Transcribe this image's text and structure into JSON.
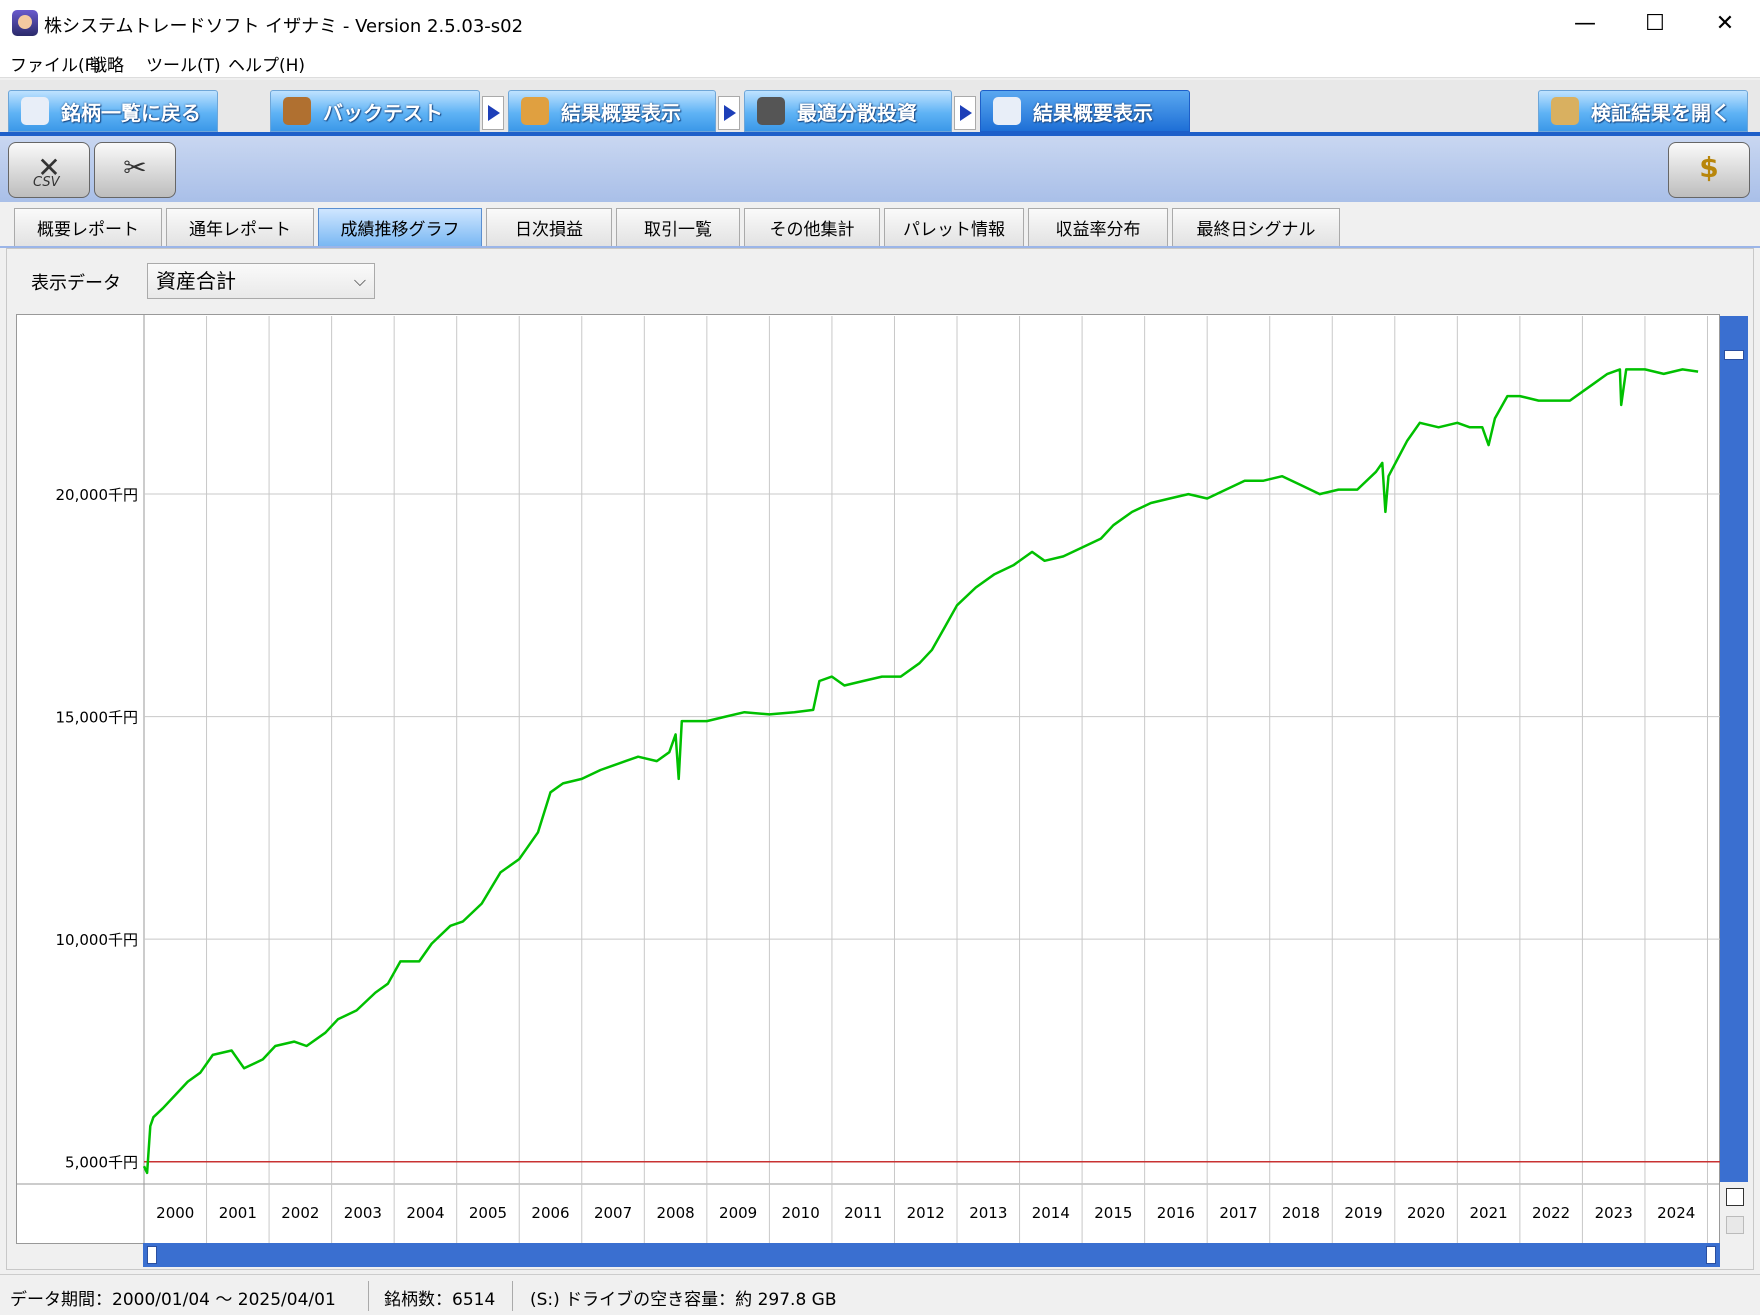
{
  "window": {
    "title": "株システムトレードソフト イザナミ - Version 2.5.03-s02",
    "minimize": "—",
    "maximize": "☐",
    "close": "✕"
  },
  "menu": [
    "ファイル(F)",
    "戦略",
    "ツール(T)",
    "ヘルプ(H)"
  ],
  "main_tabs": {
    "back": "銘柄一覧に戻る",
    "backtest": "バックテスト",
    "summary1": "結果概要表示",
    "optimal": "最適分散投資",
    "summary2": "結果概要表示",
    "open_results": "検証結果を開く"
  },
  "toolbar": {
    "csv_label": "CSV"
  },
  "sub_tabs": [
    "概要レポート",
    "通年レポート",
    "成績推移グラフ",
    "日次損益",
    "取引一覧",
    "その他集計",
    "パレット情報",
    "収益率分布",
    "最終日シグナル"
  ],
  "active_sub_tab": "成績推移グラフ",
  "display_data": {
    "label": "表示データ",
    "selected": "資産合計"
  },
  "colors": {
    "line": "#00c000",
    "baseline": "#c83232",
    "accent": "#1d5fc9"
  },
  "chart_data": {
    "type": "line",
    "series": [
      {
        "values": [
          [
            2000.0,
            4900
          ],
          [
            2000.05,
            4750
          ],
          [
            2000.1,
            5800
          ],
          [
            2000.15,
            6000
          ],
          [
            2000.3,
            6200
          ],
          [
            2000.5,
            6500
          ],
          [
            2000.7,
            6800
          ],
          [
            2000.9,
            7000
          ],
          [
            2001.1,
            7400
          ],
          [
            2001.4,
            7500
          ],
          [
            2001.6,
            7100
          ],
          [
            2001.9,
            7300
          ],
          [
            2002.1,
            7600
          ],
          [
            2002.4,
            7700
          ],
          [
            2002.6,
            7600
          ],
          [
            2002.9,
            7900
          ],
          [
            2003.1,
            8200
          ],
          [
            2003.4,
            8400
          ],
          [
            2003.7,
            8800
          ],
          [
            2003.9,
            9000
          ],
          [
            2004.1,
            9500
          ],
          [
            2004.4,
            9500
          ],
          [
            2004.6,
            9900
          ],
          [
            2004.9,
            10300
          ],
          [
            2005.1,
            10400
          ],
          [
            2005.4,
            10800
          ],
          [
            2005.7,
            11500
          ],
          [
            2006.0,
            11800
          ],
          [
            2006.1,
            12000
          ],
          [
            2006.3,
            12400
          ],
          [
            2006.5,
            13300
          ],
          [
            2006.7,
            13500
          ],
          [
            2007.0,
            13600
          ],
          [
            2007.3,
            13800
          ],
          [
            2007.5,
            13900
          ],
          [
            2007.7,
            14000
          ],
          [
            2007.9,
            14100
          ],
          [
            2008.2,
            14000
          ],
          [
            2008.4,
            14200
          ],
          [
            2008.5,
            14600
          ],
          [
            2008.55,
            13600
          ],
          [
            2008.6,
            14900
          ],
          [
            2009.0,
            14900
          ],
          [
            2009.3,
            15000
          ],
          [
            2009.6,
            15100
          ],
          [
            2010.0,
            15050
          ],
          [
            2010.4,
            15100
          ],
          [
            2010.7,
            15150
          ],
          [
            2010.8,
            15800
          ],
          [
            2011.0,
            15900
          ],
          [
            2011.2,
            15700
          ],
          [
            2011.5,
            15800
          ],
          [
            2011.8,
            15900
          ],
          [
            2012.1,
            15900
          ],
          [
            2012.4,
            16200
          ],
          [
            2012.6,
            16500
          ],
          [
            2012.8,
            17000
          ],
          [
            2013.0,
            17500
          ],
          [
            2013.3,
            17900
          ],
          [
            2013.6,
            18200
          ],
          [
            2013.9,
            18400
          ],
          [
            2014.2,
            18700
          ],
          [
            2014.4,
            18500
          ],
          [
            2014.7,
            18600
          ],
          [
            2015.0,
            18800
          ],
          [
            2015.3,
            19000
          ],
          [
            2015.5,
            19300
          ],
          [
            2015.8,
            19600
          ],
          [
            2016.1,
            19800
          ],
          [
            2016.4,
            19900
          ],
          [
            2016.7,
            20000
          ],
          [
            2017.0,
            19900
          ],
          [
            2017.3,
            20100
          ],
          [
            2017.6,
            20300
          ],
          [
            2017.9,
            20300
          ],
          [
            2018.2,
            20400
          ],
          [
            2018.5,
            20200
          ],
          [
            2018.8,
            20000
          ],
          [
            2019.1,
            20100
          ],
          [
            2019.4,
            20100
          ],
          [
            2019.7,
            20500
          ],
          [
            2019.8,
            20700
          ],
          [
            2019.85,
            19600
          ],
          [
            2019.9,
            20400
          ],
          [
            2020.2,
            21200
          ],
          [
            2020.4,
            21600
          ],
          [
            2020.7,
            21500
          ],
          [
            2021.0,
            21600
          ],
          [
            2021.2,
            21500
          ],
          [
            2021.4,
            21500
          ],
          [
            2021.5,
            21100
          ],
          [
            2021.6,
            21700
          ],
          [
            2021.8,
            22200
          ],
          [
            2022.0,
            22200
          ],
          [
            2022.3,
            22100
          ],
          [
            2022.5,
            22100
          ],
          [
            2022.8,
            22100
          ],
          [
            2023.0,
            22300
          ],
          [
            2023.2,
            22500
          ],
          [
            2023.4,
            22700
          ],
          [
            2023.6,
            22800
          ],
          [
            2023.62,
            22000
          ],
          [
            2023.7,
            22800
          ],
          [
            2024.0,
            22800
          ],
          [
            2024.3,
            22700
          ],
          [
            2024.6,
            22800
          ],
          [
            2024.85,
            22750
          ]
        ]
      }
    ],
    "baseline": 5000,
    "y_ticks": [
      {
        "value": 5000,
        "label": "5,000千円"
      },
      {
        "value": 10000,
        "label": "10,000千円"
      },
      {
        "value": 15000,
        "label": "15,000千円"
      },
      {
        "value": 20000,
        "label": "20,000千円"
      }
    ],
    "x_ticks": [
      "2000",
      "2001",
      "2002",
      "2003",
      "2004",
      "2005",
      "2006",
      "2007",
      "2008",
      "2009",
      "2010",
      "2011",
      "2012",
      "2013",
      "2014",
      "2015",
      "2016",
      "2017",
      "2018",
      "2019",
      "2020",
      "2021",
      "2022",
      "2023",
      "2024"
    ],
    "xlim": [
      2000,
      2025.2
    ],
    "ylim": [
      4500,
      24000
    ],
    "grid": true
  },
  "status": {
    "period": "データ期間：2000/01/04 〜 2025/04/01",
    "count": "銘柄数：6514",
    "disk": "(S:) ドライブの空き容量：約 297.8 GB"
  }
}
